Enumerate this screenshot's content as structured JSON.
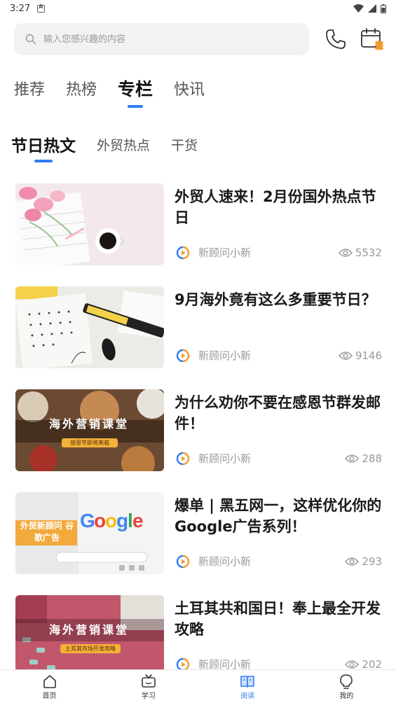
{
  "status": {
    "time": "3:27"
  },
  "search": {
    "placeholder": "输入您感兴趣的内容"
  },
  "top_tabs": [
    {
      "label": "推荐"
    },
    {
      "label": "热榜"
    },
    {
      "label": "专栏",
      "active": true
    },
    {
      "label": "快讯"
    }
  ],
  "sub_tabs": [
    {
      "label": "节日热文",
      "active": true
    },
    {
      "label": "外贸热点"
    },
    {
      "label": "干货"
    }
  ],
  "articles": [
    {
      "title": "外贸人速来！2月份国外热点节日",
      "author": "新顾问小新",
      "views": "5532",
      "image": "pink-tulips-notebook-coffee"
    },
    {
      "title": "9月海外竟有这么多重要节日？",
      "author": "新顾问小新",
      "views": "9146",
      "image": "september-calendar-marker"
    },
    {
      "title": "为什么劝你不要在感恩节群发邮件！",
      "author": "新顾问小新",
      "views": "288",
      "image": "thanksgiving-dinner-table",
      "image_text": "海外营销课堂",
      "image_badge": "感恩节即将来临"
    },
    {
      "title": "爆单 | 黑五网一，这样优化你的Google广告系列！",
      "author": "新顾问小新",
      "views": "293",
      "image": "google-search-screen",
      "image_text": "外贸新顾问 谷歌广告"
    },
    {
      "title": "土耳其共和国日！奉上最全开发攻略",
      "author": "新顾问小新",
      "views": "202",
      "image": "turkey-market-desk",
      "image_text": "海外营销课堂",
      "image_badge": "土耳其市场开发攻略"
    }
  ],
  "bottom_nav": [
    {
      "label": "首页",
      "icon": "home-icon"
    },
    {
      "label": "学习",
      "icon": "tv-icon"
    },
    {
      "label": "阅读",
      "icon": "book-icon",
      "active": true
    },
    {
      "label": "我的",
      "icon": "lightbulb-icon"
    }
  ],
  "colors": {
    "accent": "#2f7cf6",
    "author_logo_orange": "#f39a2b",
    "author_logo_blue": "#2f7cf6"
  }
}
